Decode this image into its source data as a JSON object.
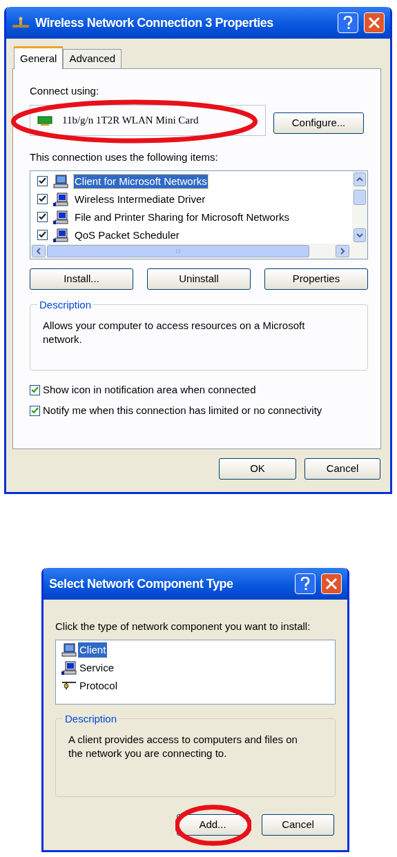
{
  "properties_dialog": {
    "title": "Wireless Network Connection 3 Properties",
    "tabs": [
      {
        "label": "General",
        "selected": true
      },
      {
        "label": "Advanced",
        "selected": false
      }
    ],
    "connect_using": {
      "label": "Connect using:",
      "device": "11b/g/n 1T2R WLAN Mini Card",
      "circled": true
    },
    "configure_button": "Configure...",
    "items_label": "This connection uses the following items:",
    "items": [
      {
        "label": "Client for Microsoft Networks",
        "kind": "client",
        "checked": true,
        "selected": true
      },
      {
        "label": "Wireless Intermediate Driver",
        "kind": "service",
        "checked": true,
        "selected": false
      },
      {
        "label": "File and Printer Sharing for Microsoft Networks",
        "kind": "service",
        "checked": true,
        "selected": false
      },
      {
        "label": "QoS Packet Scheduler",
        "kind": "service",
        "checked": true,
        "selected": false
      }
    ],
    "item_buttons": [
      "Install...",
      "Uninstall",
      "Properties"
    ],
    "description": {
      "title": "Description",
      "text": "Allows your computer to access resources on a Microsoft network."
    },
    "options": [
      {
        "label": "Show icon in notification area when connected",
        "checked": true
      },
      {
        "label": "Notify me when this connection has limited or no connectivity",
        "checked": true
      }
    ],
    "buttons": [
      {
        "label": "OK",
        "circled": false
      },
      {
        "label": "Cancel",
        "circled": false
      }
    ]
  },
  "component_dialog": {
    "title": "Select Network Component Type",
    "prompt": "Click the type of network component you want to install:",
    "components": [
      {
        "label": "Client",
        "kind": "client",
        "selected": true
      },
      {
        "label": "Service",
        "kind": "service",
        "selected": false
      },
      {
        "label": "Protocol",
        "kind": "protocol",
        "selected": false
      }
    ],
    "description": {
      "title": "Description",
      "text": "A client provides access to computers and files on the network you are connecting to."
    },
    "buttons": [
      {
        "label": "Add...",
        "circled": true
      },
      {
        "label": "Cancel",
        "circled": false
      }
    ]
  }
}
